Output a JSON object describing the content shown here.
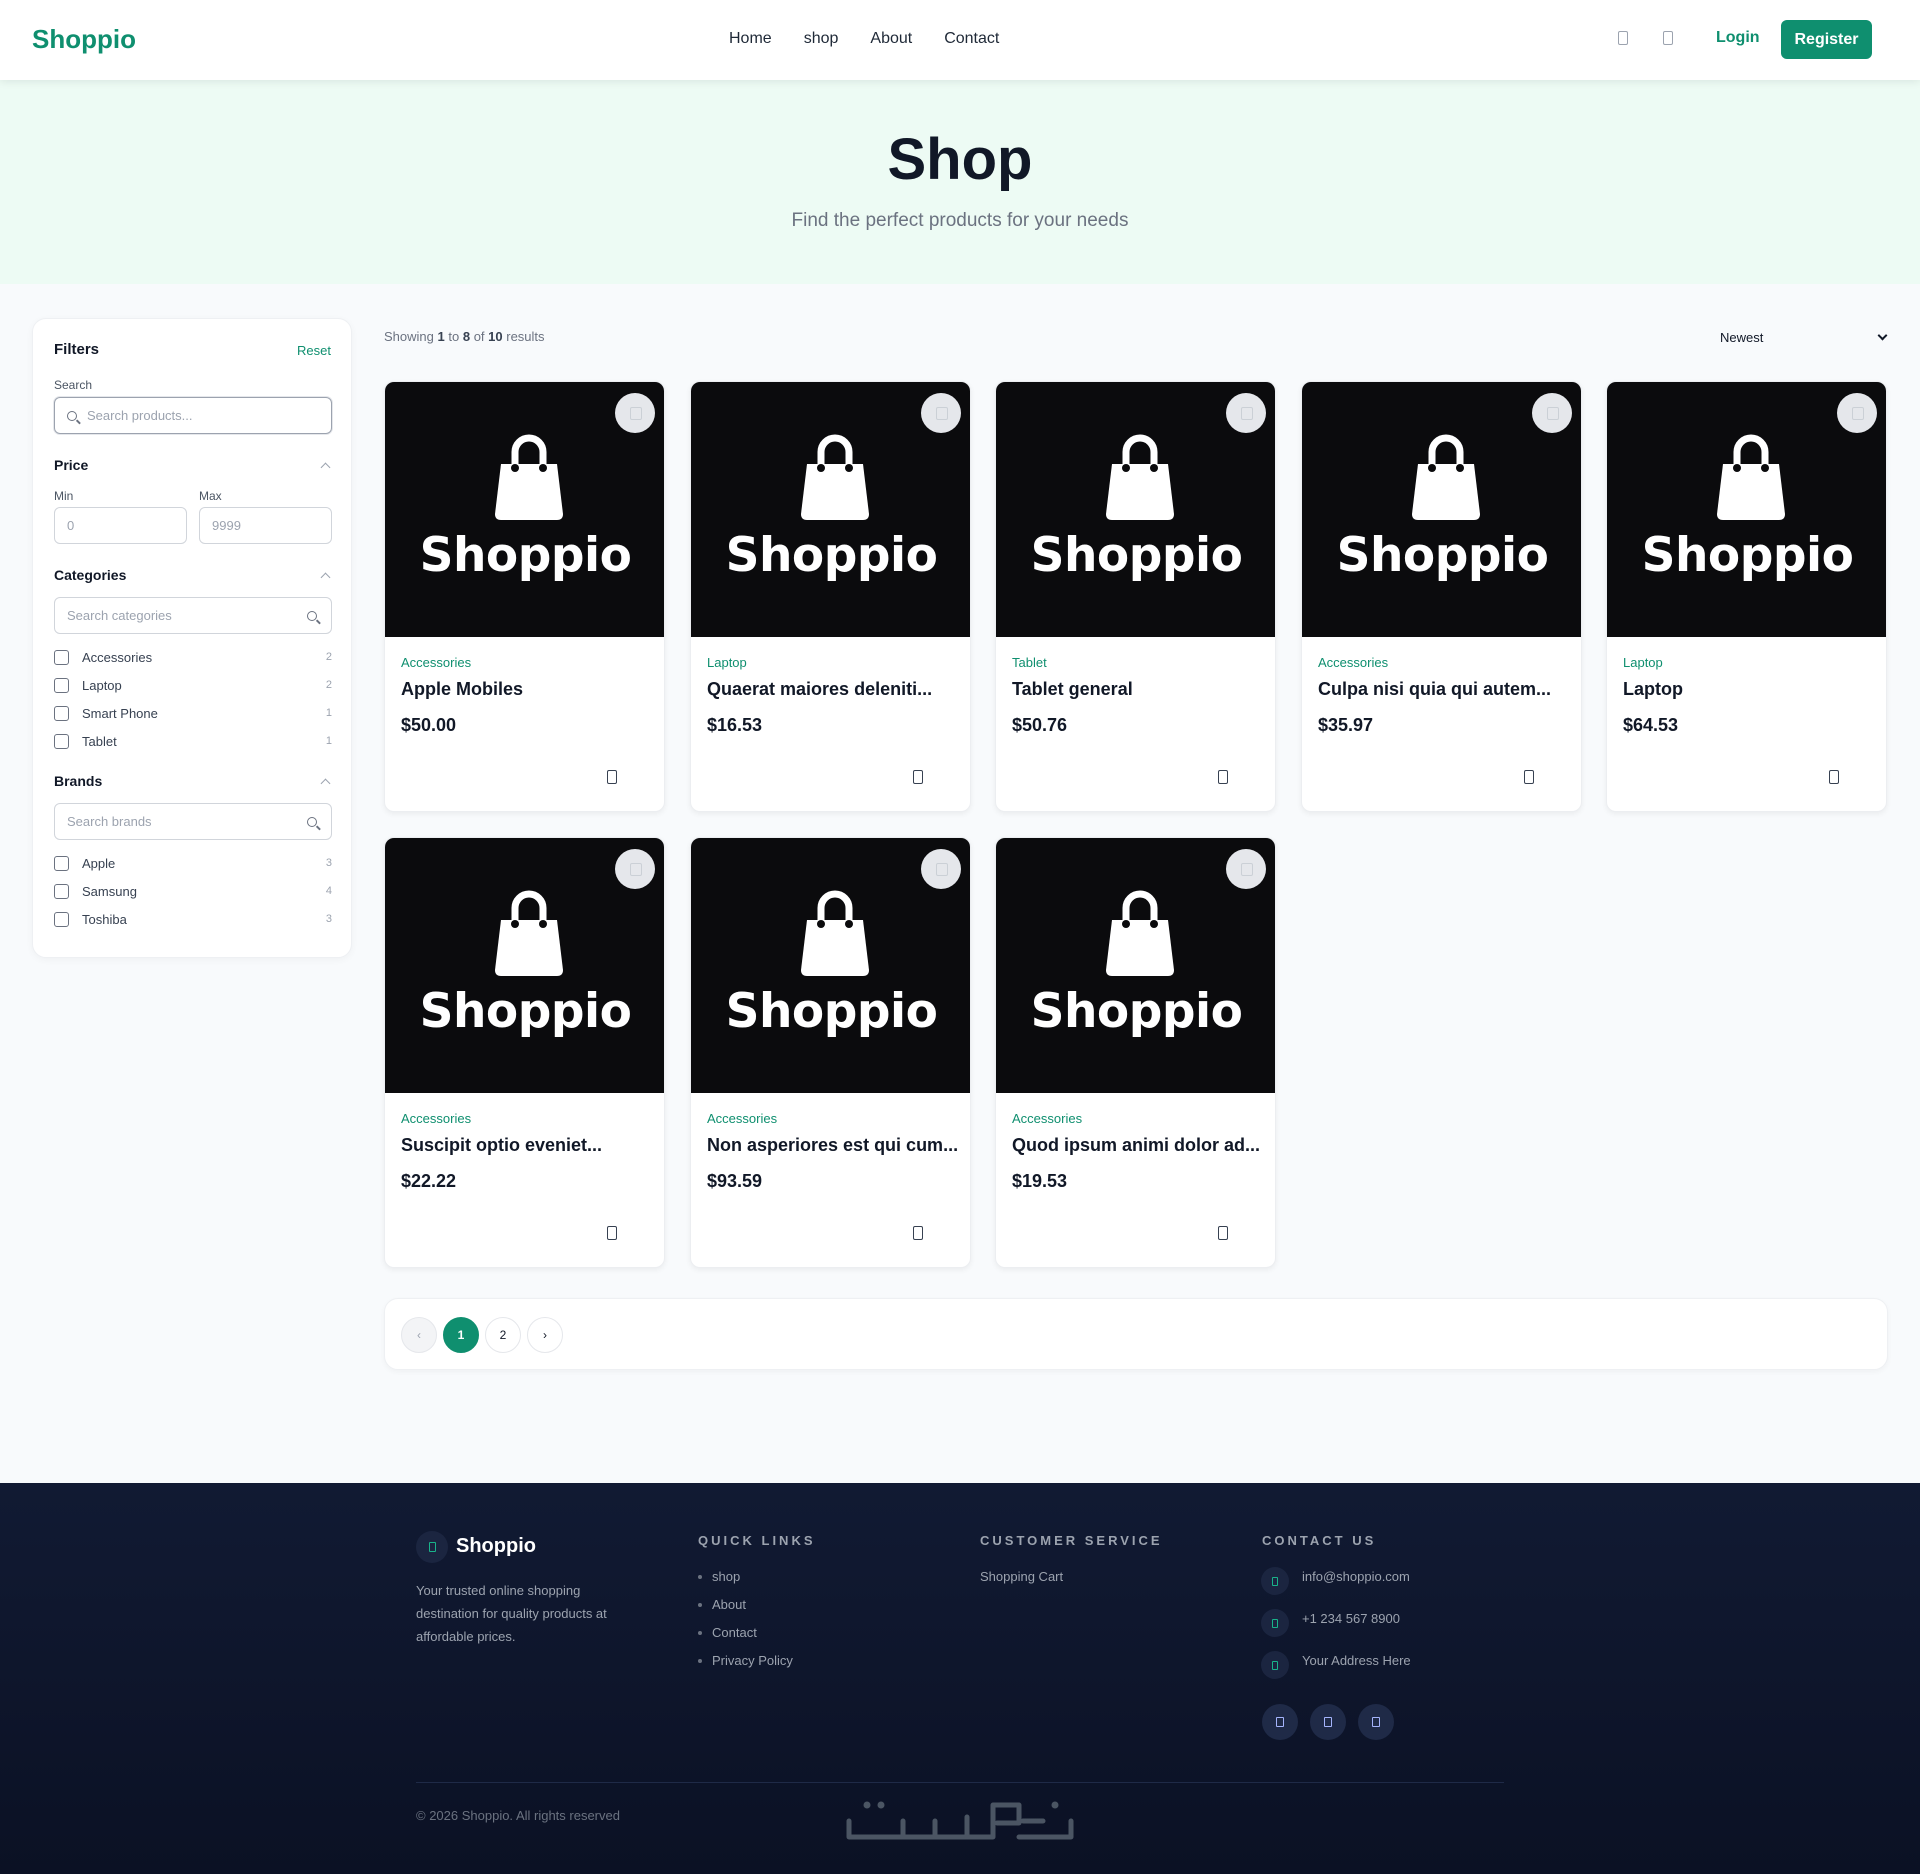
{
  "header": {
    "logo": "Shoppio",
    "nav": [
      "Home",
      "shop",
      "About",
      "Contact"
    ],
    "login": "Login",
    "register": "Register"
  },
  "hero": {
    "title": "Shop",
    "subtitle": "Find the perfect products for your needs"
  },
  "filters": {
    "title": "Filters",
    "reset": "Reset",
    "search_label": "Search",
    "search_placeholder": "Search products...",
    "price_label": "Price",
    "min_label": "Min",
    "max_label": "Max",
    "min_value": "0",
    "max_value": "9999",
    "categories_label": "Categories",
    "categories_placeholder": "Search categories",
    "categories": [
      {
        "name": "Accessories",
        "count": "2"
      },
      {
        "name": "Laptop",
        "count": "2"
      },
      {
        "name": "Smart Phone",
        "count": "1"
      },
      {
        "name": "Tablet",
        "count": "1"
      }
    ],
    "brands_label": "Brands",
    "brands_placeholder": "Search brands",
    "brands": [
      {
        "name": "Apple",
        "count": "3"
      },
      {
        "name": "Samsung",
        "count": "4"
      },
      {
        "name": "Toshiba",
        "count": "3"
      }
    ]
  },
  "results": {
    "showing_prefix": "Showing",
    "from": "1",
    "to_word": "to",
    "to": "8",
    "of_word": "of",
    "total": "10",
    "results_word": "results",
    "sort_selected": "Newest"
  },
  "products": [
    {
      "brand_text": "Shoppio",
      "category": "Accessories",
      "name": "Apple Mobiles",
      "price": "$50.00"
    },
    {
      "brand_text": "Shoppio",
      "category": "Laptop",
      "name": "Quaerat maiores deleniti...",
      "price": "$16.53"
    },
    {
      "brand_text": "Shoppio",
      "category": "Tablet",
      "name": "Tablet general",
      "price": "$50.76"
    },
    {
      "brand_text": "Shoppio",
      "category": "Accessories",
      "name": "Culpa nisi quia qui autem...",
      "price": "$35.97"
    },
    {
      "brand_text": "Shoppio",
      "category": "Laptop",
      "name": "Laptop",
      "price": "$64.53"
    },
    {
      "brand_text": "Shoppio",
      "category": "Accessories",
      "name": "Suscipit optio eveniet...",
      "price": "$22.22"
    },
    {
      "brand_text": "Shoppio",
      "category": "Accessories",
      "name": "Non asperiores est qui cum...",
      "price": "$93.59"
    },
    {
      "brand_text": "Shoppio",
      "category": "Accessories",
      "name": "Quod ipsum animi dolor ad...",
      "price": "$19.53"
    }
  ],
  "pagination": {
    "prev": "‹",
    "pages": [
      "1",
      "2"
    ],
    "current": "1",
    "next": "›"
  },
  "footer": {
    "logo": "Shoppio",
    "description": "Your trusted online shopping destination for quality products at affordable prices.",
    "quick_links_title": "QUICK LINKS",
    "quick_links": [
      "shop",
      "About",
      "Contact",
      "Privacy Policy"
    ],
    "customer_service_title": "CUSTOMER SERVICE",
    "customer_service": [
      "Shopping Cart"
    ],
    "contact_title": "CONTACT US",
    "email": "info@shoppio.com",
    "phone": "+1 234 567 8900",
    "address": "Your Address Here",
    "copyright": "© 2026 Shoppio. All rights reserved"
  },
  "colors": {
    "brand": "#0f8f6f",
    "hero_bg": "#edfbf4",
    "footer_bg": "#111a33"
  },
  "icons": {
    "search": "search-icon",
    "cart": "cart-icon",
    "wishlist": "heart-icon",
    "bag": "shopping-bag-icon",
    "chevron": "chevron-up-icon"
  }
}
